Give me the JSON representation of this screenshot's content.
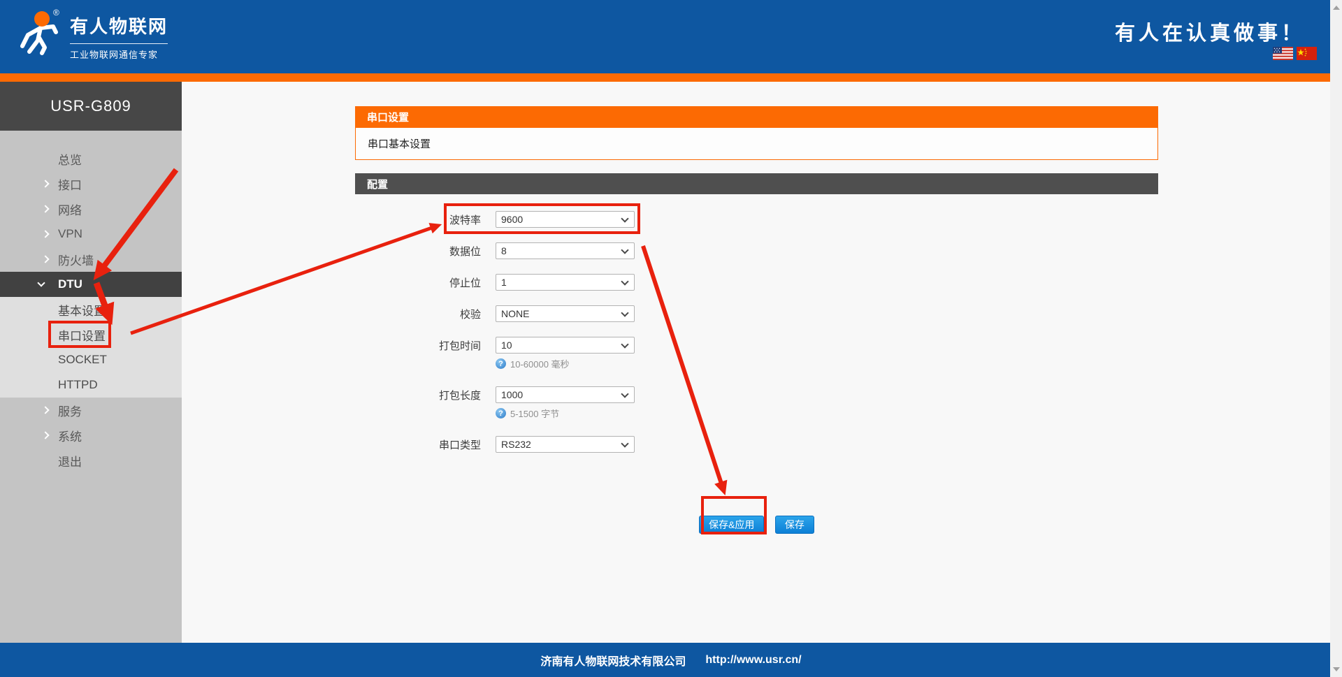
{
  "header": {
    "logo_title": "有人物联网",
    "logo_subtitle": "工业物联网通信专家",
    "registered_mark": "®",
    "slogan": "有人在认真做事！"
  },
  "sidebar": {
    "device_model": "USR-G809",
    "items": [
      {
        "name": "overview",
        "label": "总览",
        "chevron": "none",
        "level": "top"
      },
      {
        "name": "interface",
        "label": "接口",
        "chevron": "right",
        "level": "top"
      },
      {
        "name": "network",
        "label": "网络",
        "chevron": "right",
        "level": "top"
      },
      {
        "name": "vpn",
        "label": "VPN",
        "chevron": "right",
        "level": "top"
      },
      {
        "name": "firewall",
        "label": "防火墙",
        "chevron": "right",
        "level": "top"
      },
      {
        "name": "dtu",
        "label": "DTU",
        "chevron": "down",
        "level": "top",
        "active": true
      },
      {
        "name": "basic-settings",
        "label": "基本设置",
        "chevron": "none",
        "level": "sub"
      },
      {
        "name": "serial-settings",
        "label": "串口设置",
        "chevron": "none",
        "level": "sub",
        "annotated": true
      },
      {
        "name": "socket",
        "label": "SOCKET",
        "chevron": "none",
        "level": "sub"
      },
      {
        "name": "httpd",
        "label": "HTTPD",
        "chevron": "none",
        "level": "sub"
      },
      {
        "name": "services",
        "label": "服务",
        "chevron": "right",
        "level": "top"
      },
      {
        "name": "system",
        "label": "系统",
        "chevron": "right",
        "level": "top"
      },
      {
        "name": "logout",
        "label": "退出",
        "chevron": "none",
        "level": "top"
      }
    ]
  },
  "main": {
    "panel_title": "串口设置",
    "panel_subtitle": "串口基本设置",
    "section_title": "配置",
    "fields": [
      {
        "name": "baud-rate",
        "label": "波特率",
        "value": "9600",
        "highlighted": true
      },
      {
        "name": "data-bits",
        "label": "数据位",
        "value": "8"
      },
      {
        "name": "stop-bits",
        "label": "停止位",
        "value": "1"
      },
      {
        "name": "parity",
        "label": "校验",
        "value": "NONE"
      },
      {
        "name": "packing-time",
        "label": "打包时间",
        "value": "10",
        "hint": "10-60000 毫秒"
      },
      {
        "name": "packing-length",
        "label": "打包长度",
        "value": "1000",
        "hint": "5-1500 字节"
      },
      {
        "name": "serial-type",
        "label": "串口类型",
        "value": "RS232"
      }
    ],
    "buttons": {
      "save_apply": "保存&应用",
      "save": "保存"
    }
  },
  "footer": {
    "company": "济南有人物联网技术有限公司",
    "url": "http://www.usr.cn/"
  },
  "icons": {
    "help": "?"
  },
  "colors": {
    "brand_blue": "#0e57a1",
    "accent_orange": "#fc6a03",
    "sidebar_gray": "#c4c4c4",
    "sidebar_dark": "#474747",
    "submenu_gray": "#dfdfdf",
    "section_gray": "#4f4f4f",
    "page_bg": "#f8f8f8",
    "button_blue": "#0d80d6",
    "annotation_red": "#e8210e",
    "hint_gray": "#8f8f8f"
  }
}
